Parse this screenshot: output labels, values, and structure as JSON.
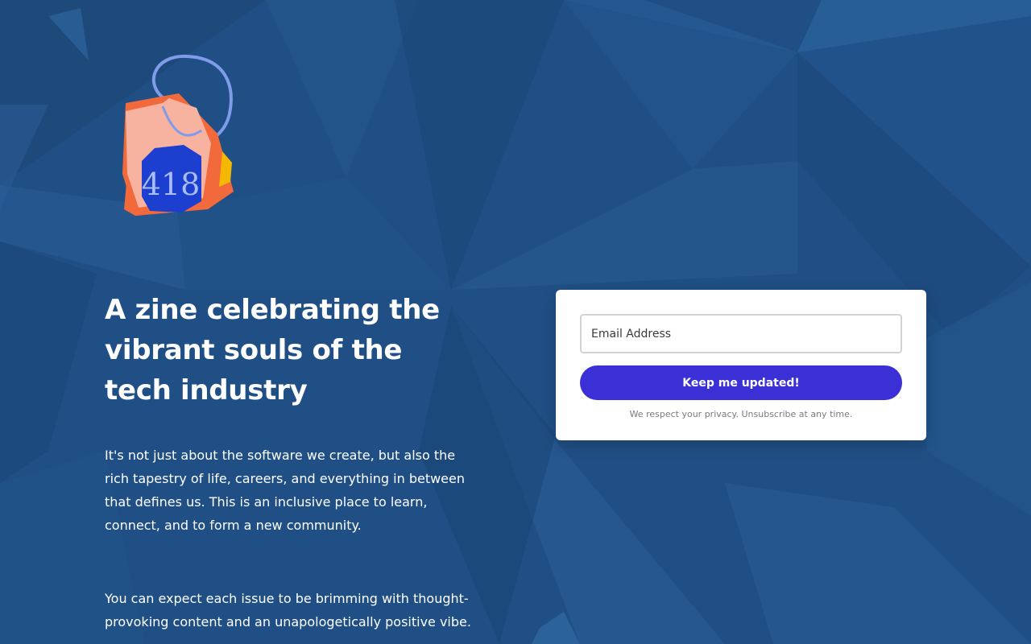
{
  "hero": {
    "logo_name": "tea-bag-418-logo",
    "logo_text": "418",
    "headline": "A zine celebrating the vibrant souls of the tech industry",
    "paragraphs": [
      "It's not just about the software we create, but also the rich tapestry of life, careers, and everything in between that defines us. This is an inclusive place to learn, connect, and to form a new community.",
      "You can expect each issue to be brimming with thought-provoking content and an unapologetically positive vibe."
    ]
  },
  "signup": {
    "email_placeholder": "Email Address",
    "email_value": "",
    "button_label": "Keep me updated!",
    "privacy_note": "We respect your privacy. Unsubscribe at any time."
  },
  "colors": {
    "background": "#1f4f84",
    "facet_light": "#2a5f97",
    "facet_dark": "#1a4676",
    "button": "#3b2fd6",
    "card": "#ffffff",
    "teabag_orange": "#f26a3c",
    "teabag_peach": "#f7b3a0",
    "teabag_yellow": "#f5b800",
    "tag_blue": "#1c3fd0",
    "string": "#7f9bea"
  }
}
